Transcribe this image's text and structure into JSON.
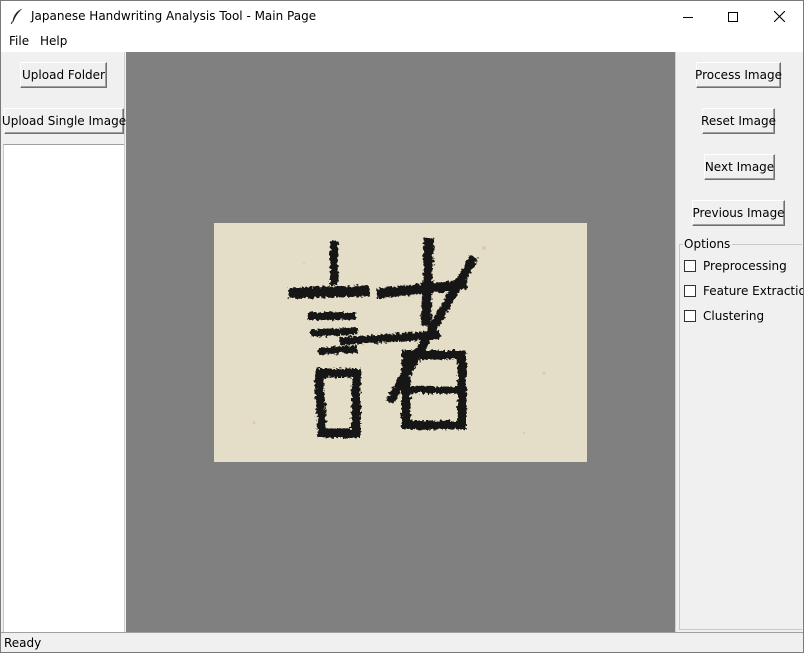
{
  "window": {
    "title": "Japanese Handwriting Analysis Tool - Main Page",
    "app_icon": "feather-icon"
  },
  "menubar": {
    "items": [
      {
        "label": "File"
      },
      {
        "label": "Help"
      }
    ]
  },
  "left_panel": {
    "upload_folder_label": "Upload Folder",
    "upload_single_label": "Upload Single Image",
    "file_list": []
  },
  "canvas": {
    "background_color": "#808080",
    "image_background_color": "#e4ddc7",
    "image_content": "諸"
  },
  "right_panel": {
    "process_label": "Process Image",
    "reset_label": "Reset Image",
    "next_label": "Next Image",
    "previous_label": "Previous Image",
    "options": {
      "legend": "Options",
      "items": [
        {
          "label": "Preprocessing",
          "checked": false
        },
        {
          "label": "Feature Extraction",
          "checked": false
        },
        {
          "label": "Clustering",
          "checked": false
        }
      ]
    }
  },
  "statusbar": {
    "text": "Ready"
  }
}
